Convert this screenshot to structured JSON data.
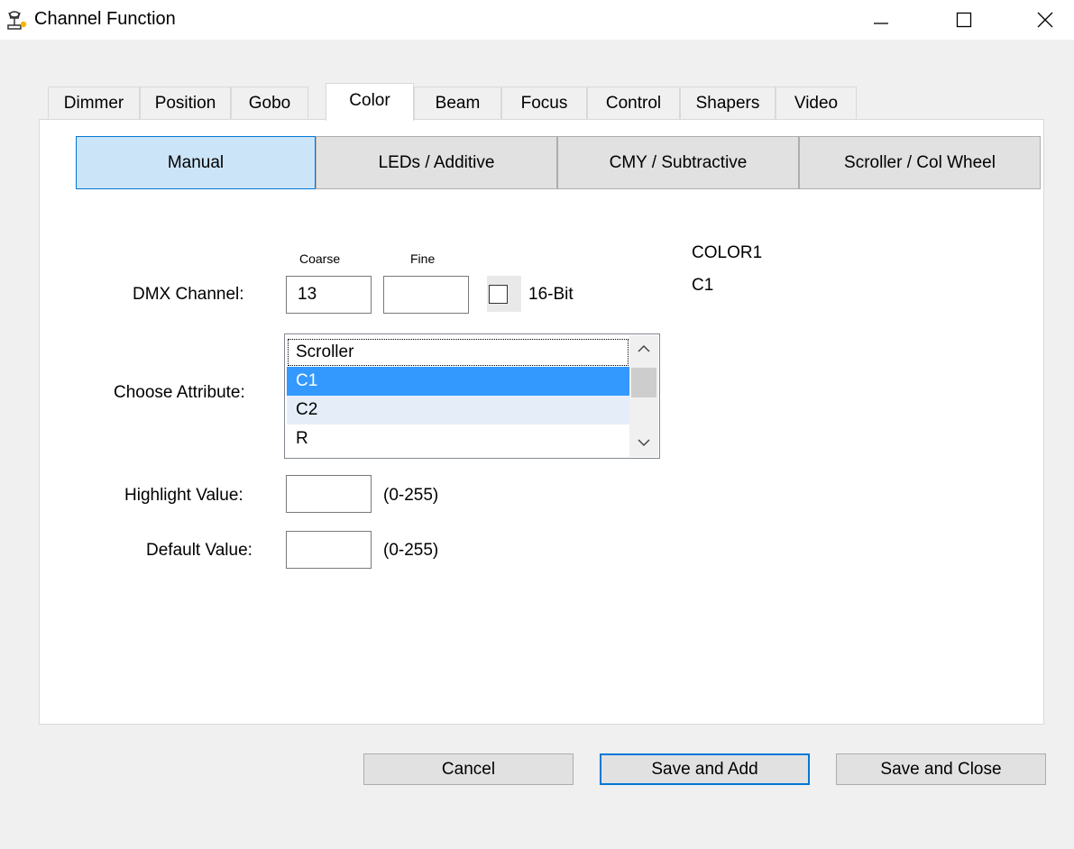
{
  "window": {
    "title": "Channel Function",
    "controls": {
      "minimize": "minimize",
      "maximize": "maximize",
      "close": "close"
    }
  },
  "tabs": [
    {
      "label": "Dimmer",
      "active": false
    },
    {
      "label": "Position",
      "active": false
    },
    {
      "label": "Gobo",
      "active": false
    },
    {
      "label": "Color",
      "active": true
    },
    {
      "label": "Beam",
      "active": false
    },
    {
      "label": "Focus",
      "active": false
    },
    {
      "label": "Control",
      "active": false
    },
    {
      "label": "Shapers",
      "active": false
    },
    {
      "label": "Video",
      "active": false
    }
  ],
  "subtabs": [
    {
      "label": "Manual",
      "active": true
    },
    {
      "label": "LEDs / Additive",
      "active": false
    },
    {
      "label": "CMY / Subtractive",
      "active": false
    },
    {
      "label": "Scroller / Col Wheel",
      "active": false
    }
  ],
  "form": {
    "coarse_label": "Coarse",
    "fine_label": "Fine",
    "dmx_channel_label": "DMX Channel:",
    "coarse_value": "13",
    "fine_value": "",
    "sixteen_bit_label": "16-Bit",
    "sixteen_bit_checked": false,
    "choose_attribute_label": "Choose Attribute:",
    "attributes": [
      "Scroller",
      "C1",
      "C2",
      "R"
    ],
    "selected_attribute": "C1",
    "highlight_label": "Highlight Value:",
    "highlight_value": "",
    "highlight_range": "(0-255)",
    "default_label": "Default Value:",
    "default_value": "",
    "default_range": "(0-255)"
  },
  "info": {
    "line1": "COLOR1",
    "line2": "C1"
  },
  "buttons": {
    "cancel": "Cancel",
    "save_add": "Save and Add",
    "save_close": "Save and Close"
  },
  "colors": {
    "accent": "#0078d7",
    "selection": "#3399ff",
    "active_subtab": "#cce4f7"
  }
}
